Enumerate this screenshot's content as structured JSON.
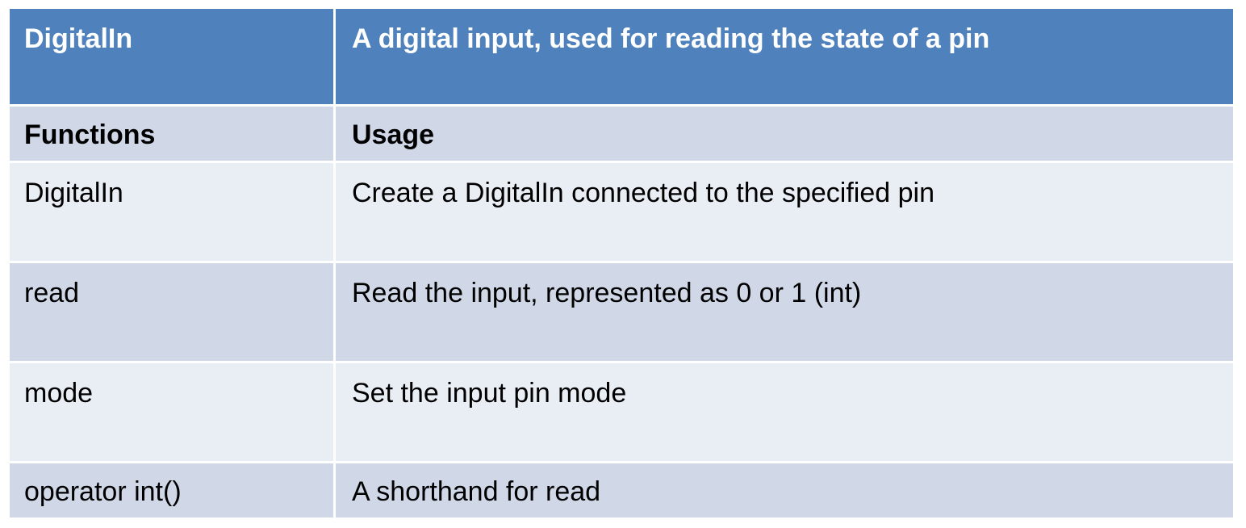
{
  "table": {
    "header": {
      "class_name": "DigitalIn",
      "description": "A digital input, used for reading the state of a pin"
    },
    "columns": {
      "functions": "Functions",
      "usage": "Usage"
    },
    "rows": [
      {
        "function": "DigitalIn",
        "usage": "Create a DigitalIn connected to the specified pin"
      },
      {
        "function": "read",
        "usage": "Read the input, represented as 0 or 1 (int)"
      },
      {
        "function": "mode",
        "usage": "Set the input pin mode"
      },
      {
        "function": "operator int()",
        "usage": "A shorthand for read"
      }
    ]
  },
  "colors": {
    "header_bg": "#4f81bd",
    "row_dark": "#d0d8e8",
    "row_light": "#e9edf4"
  }
}
